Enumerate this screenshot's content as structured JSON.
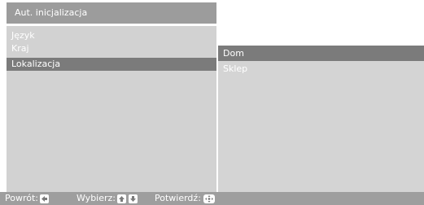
{
  "title": "Aut. inicjalizacja",
  "menu": {
    "items": [
      {
        "label": "Język"
      },
      {
        "label": "Kraj"
      },
      {
        "label": "Lokalizacja"
      }
    ],
    "selected_index": 2
  },
  "submenu": {
    "items": [
      {
        "label": "Dom"
      },
      {
        "label": "Sklep"
      }
    ],
    "selected_index": 0
  },
  "status_bar": {
    "back_label": "Powrót:",
    "back_icon": "arrow-left-icon",
    "select_label": "Wybierz:",
    "select_icons": [
      "arrow-up-icon",
      "arrow-down-icon"
    ],
    "confirm_label": "Potwierdź:",
    "confirm_icon": "enter-key-icon"
  },
  "colors": {
    "title_bar": "#9c9c9c",
    "menu_panel": "#d2d2d2",
    "selected_row": "#7b7b7b",
    "status_bar": "#9e9e9e",
    "text": "#ffffff"
  }
}
